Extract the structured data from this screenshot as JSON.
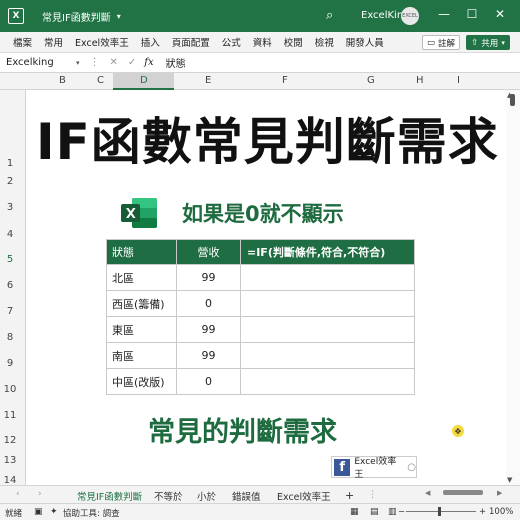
{
  "titlebar": {
    "app_icon": "X",
    "doc_title": "常見IF函數判斷",
    "user_name": "ExcelKing",
    "avatar_text": "EXCEL",
    "minimize": "—",
    "restore": "☐",
    "close": "✕",
    "search_icon": "⌕"
  },
  "ribbon": {
    "tabs": [
      "檔案",
      "常用",
      "Excel效率王",
      "插入",
      "頁面配置",
      "公式",
      "資料",
      "校閱",
      "檢視",
      "開發人員"
    ],
    "comment_label": "註解",
    "share_label": "共用"
  },
  "formula_bar": {
    "name_box": "Excelking",
    "fx": "fx",
    "content": "狀態"
  },
  "columns": [
    "B",
    "C",
    "D",
    "E",
    "F",
    "G",
    "H",
    "I"
  ],
  "selected_column": "D",
  "rows": [
    "1",
    "2",
    "3",
    "4",
    "5",
    "6",
    "7",
    "8",
    "9",
    "10",
    "11",
    "12",
    "13",
    "14"
  ],
  "selected_row": "5",
  "sheet": {
    "big_title": "IF函數常見判斷需求",
    "subtitle": "如果是0就不顯示",
    "bottom_title": "常見的判斷需求",
    "table": {
      "headers": [
        "狀態",
        "營收",
        "=IF(判斷條件,符合,不符合)"
      ],
      "rows": [
        [
          "北區",
          "99",
          ""
        ],
        [
          "西區(籌備)",
          "0",
          ""
        ],
        [
          "東區",
          "99",
          ""
        ],
        [
          "南區",
          "99",
          ""
        ],
        [
          "中區(改版)",
          "0",
          ""
        ]
      ]
    },
    "badge_text": "Excel效率王",
    "badge_icon": "f"
  },
  "sheet_tabs": {
    "tabs": [
      "常見IF函數判斷",
      "不等於",
      "小於",
      "錯誤值",
      "Excel效率王"
    ],
    "active": "常見IF函數判斷",
    "add_icon": "+"
  },
  "statusbar": {
    "ready": "就緒",
    "accessibility": "協助工具: 調查",
    "zoom": "100%"
  },
  "colors": {
    "brand_green": "#217346",
    "header_green": "#1f6e43",
    "text_green": "#1d6b3e"
  }
}
